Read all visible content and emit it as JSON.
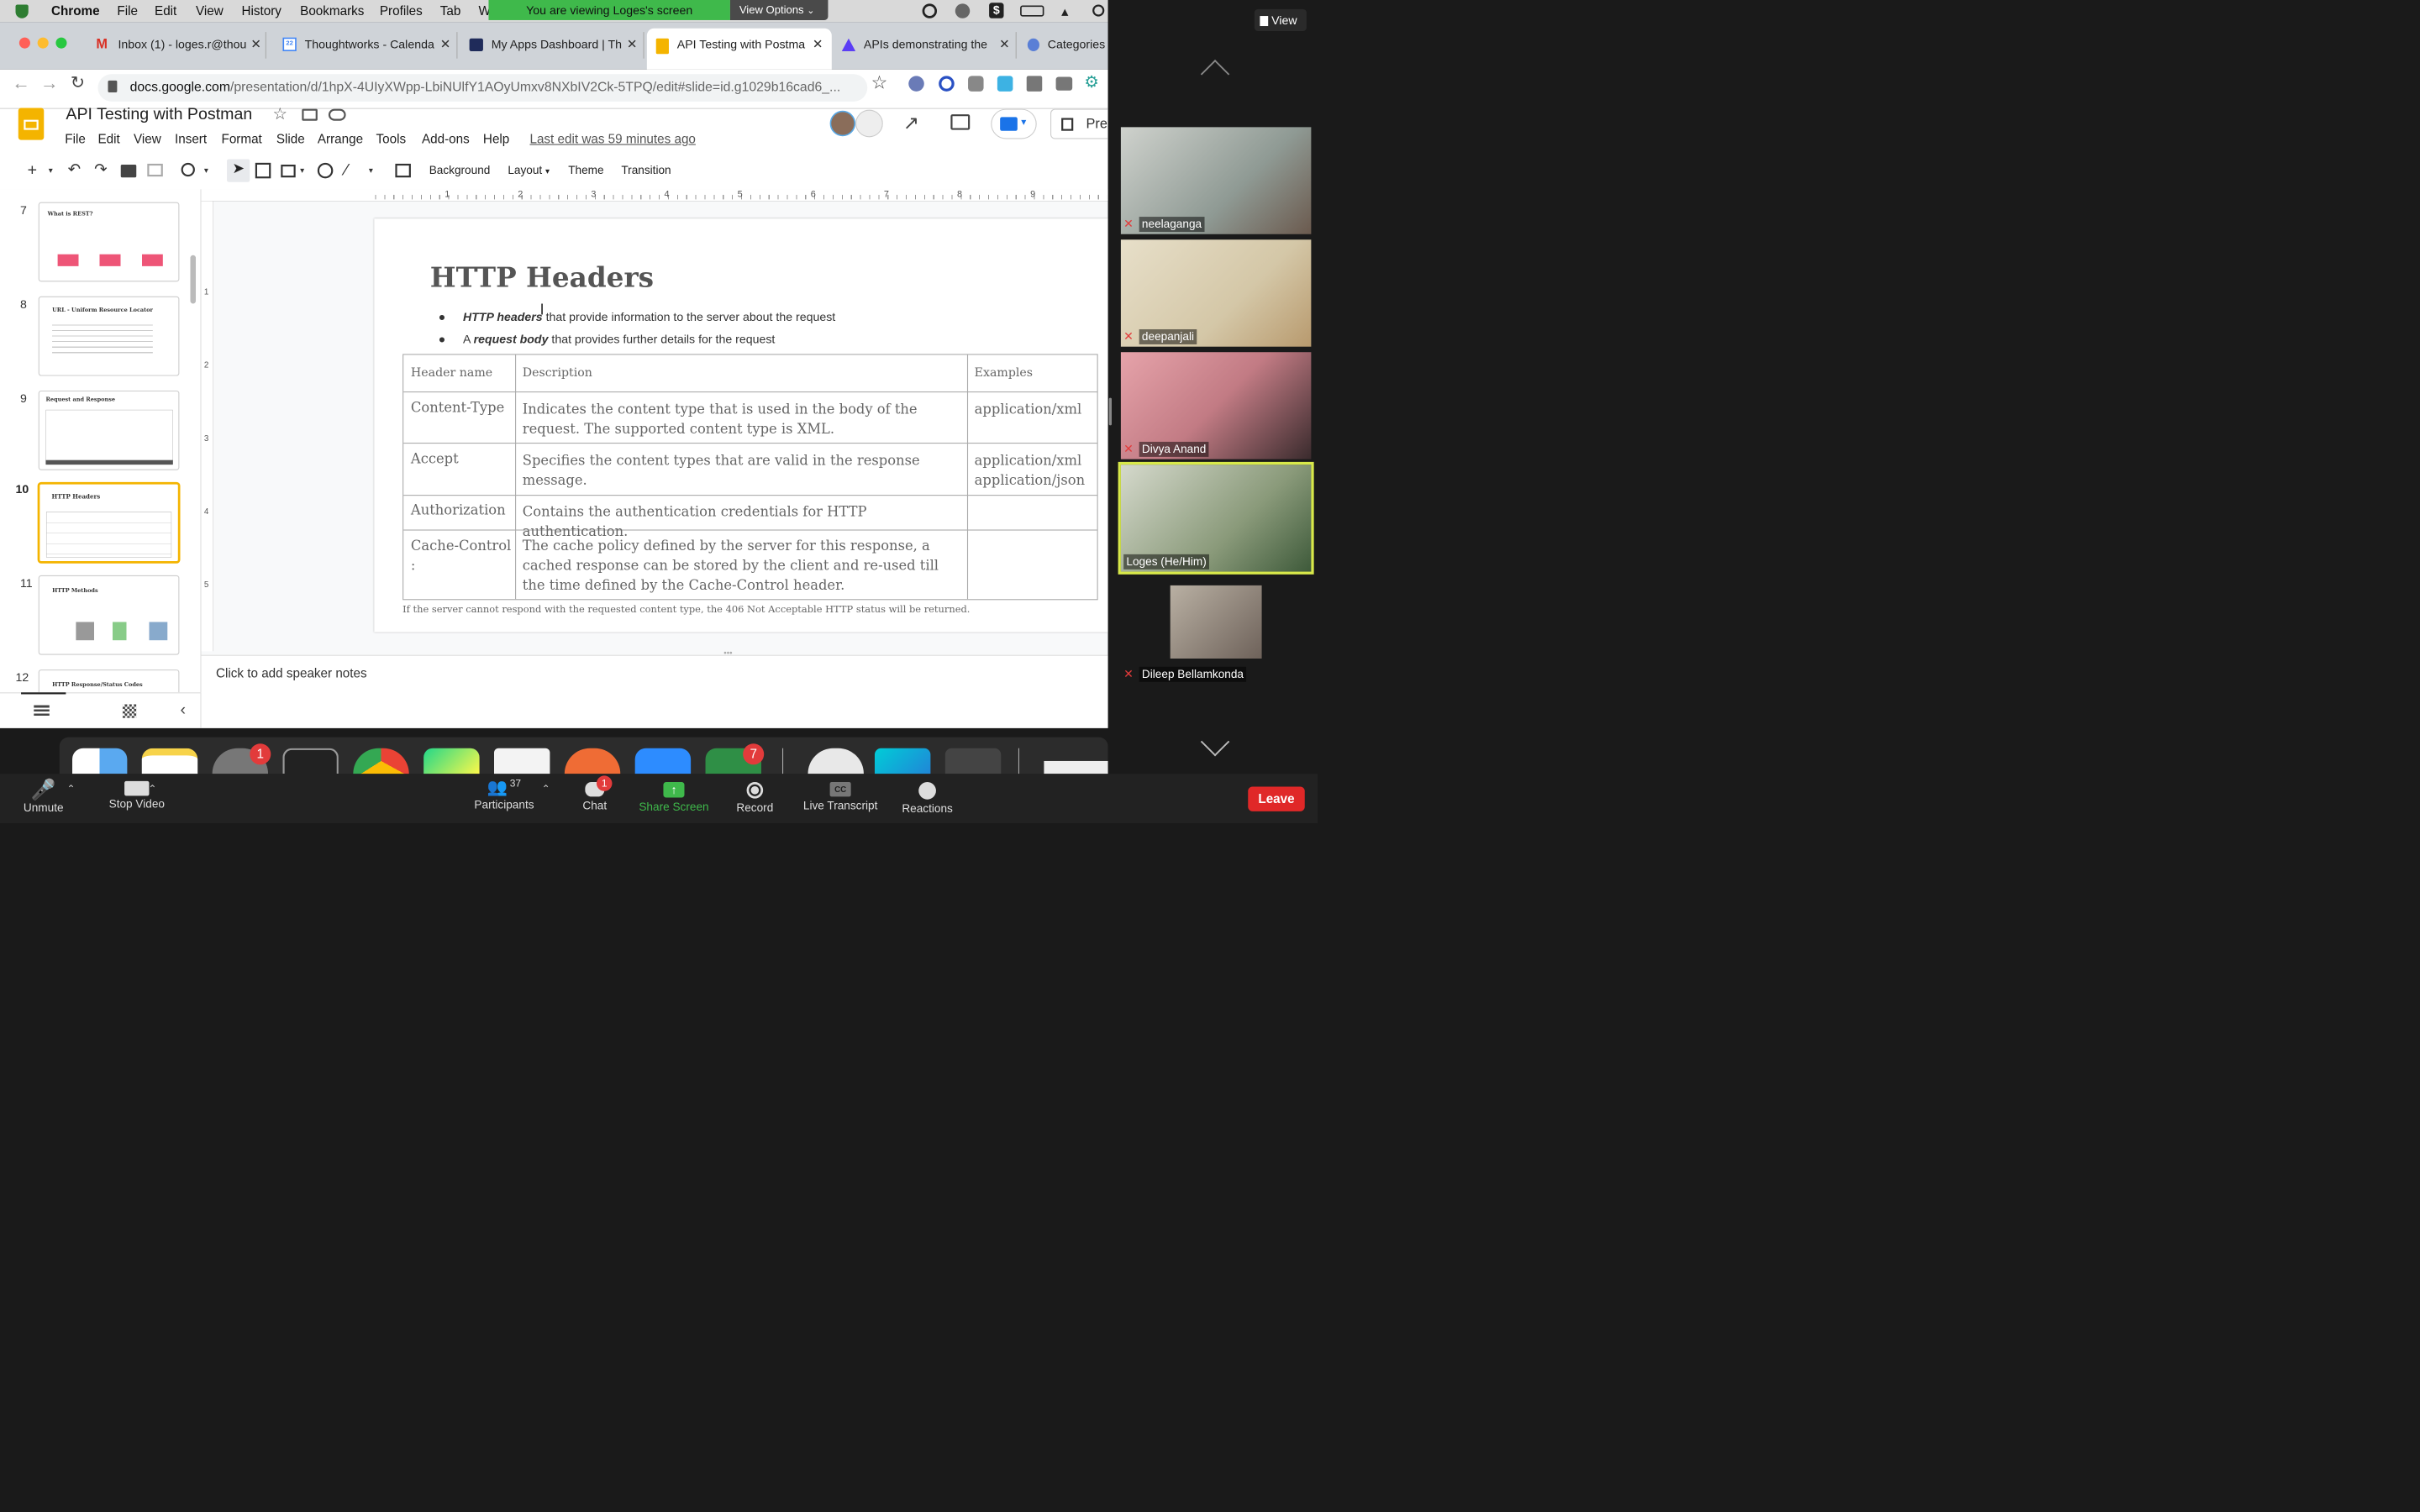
{
  "macbar": {
    "app": "Chrome",
    "menus": [
      "File",
      "Edit",
      "View",
      "History",
      "Bookmarks",
      "Profiles",
      "Tab",
      "W"
    ]
  },
  "zoom_banner": {
    "text": "You are viewing Loges's screen",
    "options": "View Options"
  },
  "tabs": [
    {
      "label": "Inbox (1) - loges.r@thou",
      "icon": "gmail-icon"
    },
    {
      "label": "Thoughtworks - Calenda",
      "icon": "calendar-icon"
    },
    {
      "label": "My Apps Dashboard | Th",
      "icon": "okta-icon"
    },
    {
      "label": "API Testing with Postma",
      "icon": "slides-icon"
    },
    {
      "label": "APIs demonstrating the",
      "icon": "miro-icon"
    },
    {
      "label": "Categories",
      "icon": "generic-icon"
    }
  ],
  "address": {
    "domain": "docs.google.com",
    "path": "/presentation/d/1hpX-4UIyXWpp-LbiNUlfY1AOyUmxv8NXbIV2Ck-5TPQ/edit#slide=id.g1029b16cad6_..."
  },
  "doc": {
    "title": "API Testing with Postman",
    "menus": [
      "File",
      "Edit",
      "View",
      "Insert",
      "Format",
      "Slide",
      "Arrange",
      "Tools",
      "Add-ons",
      "Help"
    ],
    "last_edit": "Last edit was 59 minutes ago",
    "present": "Pres"
  },
  "toolbar": {
    "background": "Background",
    "layout": "Layout",
    "theme": "Theme",
    "transition": "Transition"
  },
  "ruler": [
    "1",
    "2",
    "3",
    "4",
    "5",
    "6",
    "7",
    "8",
    "9"
  ],
  "vruler": [
    "1",
    "2",
    "3",
    "4",
    "5"
  ],
  "thumbs": [
    {
      "num": "7",
      "title": "What is REST?"
    },
    {
      "num": "8",
      "title": "URL - Uniform Resource Locator"
    },
    {
      "num": "9",
      "title": "Request and Response"
    },
    {
      "num": "10",
      "title": "HTTP Headers"
    },
    {
      "num": "11",
      "title": "HTTP Methods"
    },
    {
      "num": "12",
      "title": "HTTP Response/Status Codes"
    }
  ],
  "slide": {
    "title": "HTTP Headers",
    "bullet1_em": "HTTP headers",
    "bullet1_rest": " that provide information to the server about the request",
    "bullet2_pre": "A ",
    "bullet2_em": "request body",
    "bullet2_rest": " that provides further details for the request",
    "table_headers": [
      "Header name",
      "Description",
      "Examples"
    ],
    "rows": [
      {
        "name": "Content-Type",
        "desc": "Indicates the content type that is used in the body of the request. The supported content type is XML.",
        "ex": "application/xml"
      },
      {
        "name": "Accept",
        "desc": "Specifies the content types that are valid in the response message.",
        "ex": "application/xml application/json"
      },
      {
        "name": "Authorization",
        "desc": "Contains the authentication credentials for HTTP authentication.",
        "ex": ""
      },
      {
        "name": "Cache-Control :",
        "desc": "The cache policy defined by the server for this response, a cached response can be stored by the client and re-used till the time defined by the Cache-Control header.",
        "ex": ""
      }
    ],
    "footnote": "If the server cannot respond with the requested content type, the 406 Not Acceptable HTTP status will be returned."
  },
  "speaker_notes": "Click to add speaker notes",
  "dock": {
    "badge_settings": "1",
    "badge_todo": "7"
  },
  "participants_panel": {
    "view": "View",
    "people": [
      {
        "name": "neelaganga",
        "muted": true
      },
      {
        "name": "deepanjali",
        "muted": true
      },
      {
        "name": "Divya Anand",
        "muted": true
      },
      {
        "name": "Loges  (He/Him)",
        "muted": false
      },
      {
        "name": "Dileep Bellamkonda",
        "muted": true
      }
    ]
  },
  "zoom_controls": {
    "unmute": "Unmute",
    "stop_video": "Stop Video",
    "participants": "Participants",
    "participants_count": "37",
    "chat": "Chat",
    "chat_badge": "1",
    "share_screen": "Share Screen",
    "record": "Record",
    "live_transcript": "Live Transcript",
    "reactions": "Reactions",
    "leave": "Leave"
  },
  "colors": {
    "zoom_green": "#3fb94b",
    "slides_yellow": "#f4b400",
    "leave_red": "#e02828",
    "active_speaker": "#d8e94a"
  }
}
